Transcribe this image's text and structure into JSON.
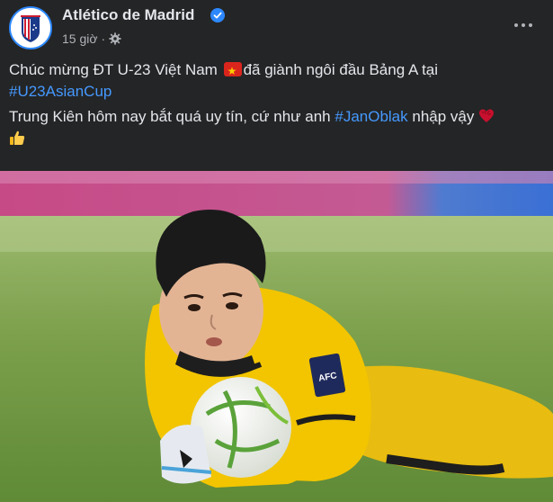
{
  "post": {
    "page_name": "Atlético de Madrid",
    "time": "15 giờ",
    "separator": "·",
    "paragraph1": {
      "text_before": "Chúc mừng ĐT U-23 Việt Nam ",
      "text_after": "đã giành ngôi đầu Bảng A tại ",
      "hashtag": "#U23AsianCup"
    },
    "paragraph2": {
      "text_before": "Trung Kiên hôm nay bắt quá uy tín, cứ như anh ",
      "hashtag": "#JanOblak",
      "text_after": " nhập vậy "
    },
    "badge_text": "AFC",
    "icons": {
      "verified": "verified-badge-icon",
      "audience": "gear-icon",
      "more": "more-options-icon",
      "flag": "vietnam-flag-emoji",
      "heart": "heart-emoji",
      "thumb": "thumbs-up-emoji"
    },
    "colors": {
      "background": "#242526",
      "text": "#e4e6eb",
      "secondary": "#b0b3b8",
      "hashtag": "#4599ff",
      "verified": "#2d88ff",
      "jersey": "#f2c500"
    }
  }
}
